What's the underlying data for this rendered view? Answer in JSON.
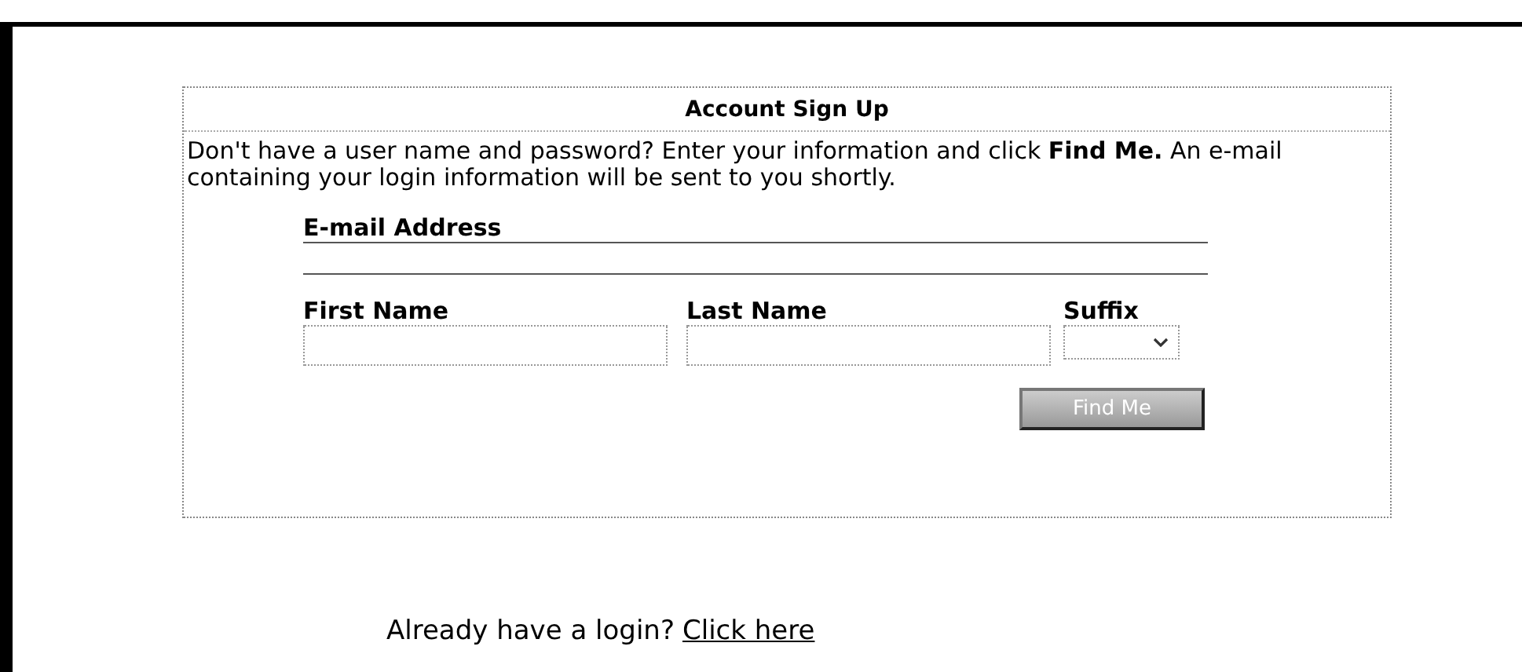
{
  "form": {
    "title": "Account Sign Up",
    "intro": "Don't have a user name and password? Enter your information and click **Find Me.** An e-mail containing your login information will be sent to you shortly.",
    "email_label": "E-mail Address",
    "first_name_label": "First Name",
    "last_name_label": "Last Name",
    "suffix_label": "Suffix",
    "submit_button": "Find Me"
  },
  "footer": {
    "text": "Already have a login?",
    "link": "Click here"
  }
}
